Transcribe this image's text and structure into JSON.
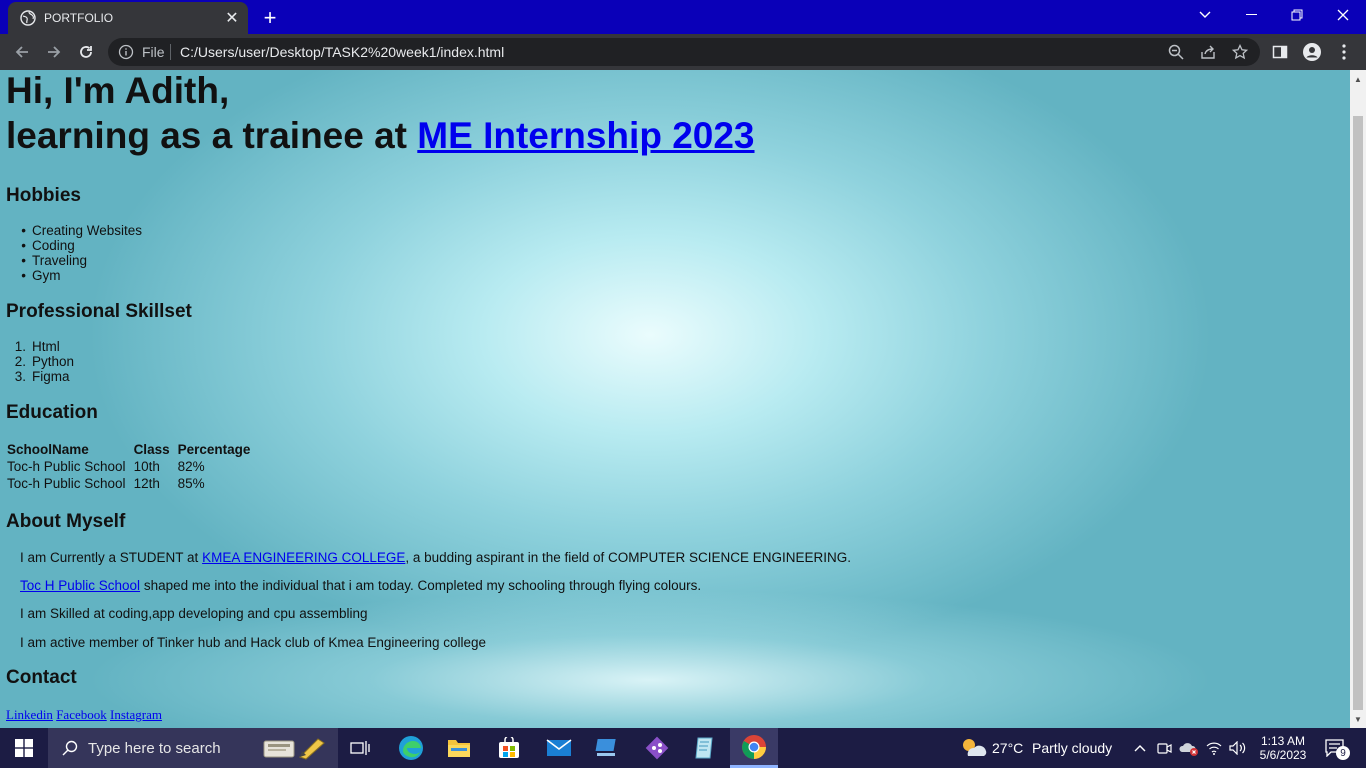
{
  "browser": {
    "tab_title": "PORTFOLIO",
    "new_tab_label": "+",
    "file_label": "File",
    "url": "C:/Users/user/Desktop/TASK2%20week1/index.html"
  },
  "page": {
    "heading_line1": "Hi, I'm Adith,",
    "heading_line2_prefix": "learning as a trainee at",
    "heading_link": "ME Internship 2023",
    "hobbies": {
      "title": "Hobbies",
      "items": [
        "Creating Websites",
        "Coding",
        "Traveling",
        "Gym"
      ]
    },
    "skills": {
      "title": "Professional Skillset",
      "items": [
        "Html",
        "Python",
        "Figma"
      ]
    },
    "education": {
      "title": "Education",
      "headers": [
        "SchoolName",
        "Class",
        "Percentage"
      ],
      "rows": [
        [
          "Toc-h Public School",
          "10th",
          "82%"
        ],
        [
          "Toc-h Public School",
          "12th",
          "85%"
        ]
      ]
    },
    "about": {
      "title": "About Myself",
      "p1_prefix": "I am Currently a STUDENT at",
      "p1_link": "KMEA ENGINEERING COLLEGE",
      "p1_suffix": ", a budding aspirant in the field of COMPUTER SCIENCE ENGINEERING.",
      "p2_link": "Toc H Public School",
      "p2_suffix": "shaped me into the individual that i am today. Completed my schooling through flying colours.",
      "p3": "I am Skilled at coding,app developing and cpu assembling",
      "p4": "I am active member of Tinker hub and Hack club of Kmea Engineering college"
    },
    "contact": {
      "title": "Contact",
      "links": [
        "Linkedin",
        "Facebook",
        "Instagram"
      ]
    }
  },
  "taskbar": {
    "search_placeholder": "Type here to search",
    "weather_temp": "27°C",
    "weather_desc": "Partly cloudy",
    "time": "1:13 AM",
    "date": "5/6/2023",
    "notification_count": "9"
  },
  "colors": {
    "titlebar": "#0a00b8",
    "toolbar": "#35363a",
    "link": "#0000ee",
    "taskbar": "#1c1c44"
  }
}
